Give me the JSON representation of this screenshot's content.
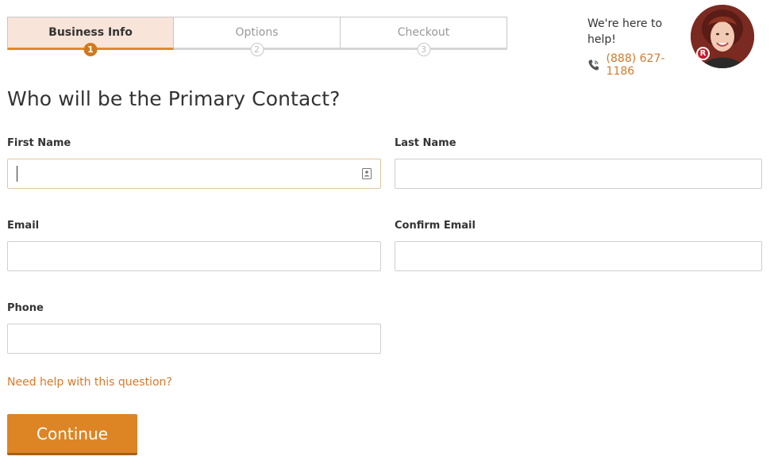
{
  "steps": [
    {
      "label": "Business Info",
      "number": "1",
      "active": true
    },
    {
      "label": "Options",
      "number": "2",
      "active": false
    },
    {
      "label": "Checkout",
      "number": "3",
      "active": false
    }
  ],
  "help": {
    "tagline": "We're here to help!",
    "phone": "(888) 627-1186",
    "badge_letter": "R"
  },
  "form": {
    "title": "Who will be the Primary Contact?",
    "first_name": {
      "label": "First Name",
      "value": ""
    },
    "last_name": {
      "label": "Last Name",
      "value": ""
    },
    "email": {
      "label": "Email",
      "value": ""
    },
    "confirm_email": {
      "label": "Confirm Email",
      "value": ""
    },
    "phone": {
      "label": "Phone",
      "value": ""
    },
    "help_link": "Need help with this question?",
    "continue_label": "Continue"
  },
  "colors": {
    "accent": "#dd8525",
    "link": "#d9782a",
    "active_step_bg": "#f8e4d8"
  }
}
